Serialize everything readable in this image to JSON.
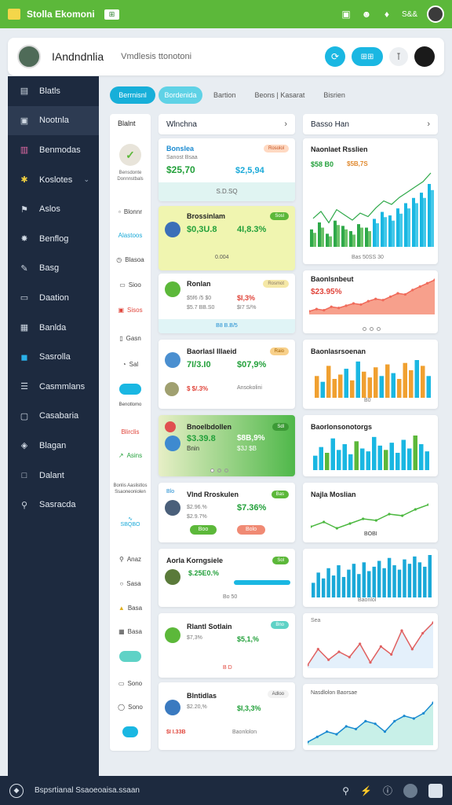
{
  "topbar": {
    "app_name": "Stolla Ekomoni",
    "badge": "⊞",
    "icons": [
      "screen-icon",
      "person-icon",
      "bell-icon"
    ],
    "status_text": "S&&"
  },
  "header": {
    "title": "IAndndnlia",
    "subtitle": "Vmdlesis ttonotoni",
    "pill_label": "⊞⊞",
    "gray_label": "⊺"
  },
  "sidebar": {
    "items": [
      {
        "label": "Blatls",
        "icon": "document-icon"
      },
      {
        "label": "Nootnla",
        "icon": "folder-icon"
      },
      {
        "label": "Benmodas",
        "icon": "chart-icon"
      },
      {
        "label": "Koslotes",
        "icon": "puzzle-icon"
      },
      {
        "label": "Aslos",
        "icon": "flag-icon"
      },
      {
        "label": "Benflog",
        "icon": "bug-icon"
      },
      {
        "label": "Basg",
        "icon": "pen-icon"
      },
      {
        "label": "Daation",
        "icon": "monitor-icon"
      },
      {
        "label": "Banlda",
        "icon": "calendar-icon"
      },
      {
        "label": "Sasrolla",
        "icon": "app-icon"
      },
      {
        "label": "Casmmlans",
        "icon": "list-icon"
      },
      {
        "label": "Casabaria",
        "icon": "box-icon"
      },
      {
        "label": "Blagan",
        "icon": "map-icon"
      },
      {
        "label": "Dalant",
        "icon": "square-icon"
      },
      {
        "label": "Sasracda",
        "icon": "search-icon"
      }
    ]
  },
  "tabs": [
    {
      "label": "Berrnisnl",
      "style": "primary"
    },
    {
      "label": "Bordenida",
      "style": "secondary"
    },
    {
      "label": "Bartion",
      "style": "plain"
    },
    {
      "label": "Beons | Kasarat",
      "style": "plain"
    },
    {
      "label": "Bisrien",
      "style": "plain"
    }
  ],
  "left_column": {
    "heading": "Blalnt",
    "items": [
      {
        "label": "Bensdonte Donnnstbals"
      },
      {
        "label": "Blonnr"
      },
      {
        "label": "Alastoos"
      },
      {
        "label": "Blasoa"
      },
      {
        "label": "Sioo"
      },
      {
        "label": "Sisos"
      },
      {
        "label": "Gasn"
      },
      {
        "label": "Sal"
      },
      {
        "label": "Benotlomo"
      },
      {
        "label": "Blirclis"
      },
      {
        "label": "Asins"
      },
      {
        "label": "Bonlis Aaslistlos Ssaoneoniolen"
      },
      {
        "label": "SBQBO"
      },
      {
        "label": "Anaz"
      },
      {
        "label": "Sasa"
      },
      {
        "label": "Basa"
      },
      {
        "label": "Basa"
      },
      {
        "label": "Sono"
      },
      {
        "label": "Sono"
      }
    ]
  },
  "mid_header": "Wlnchna",
  "right_header": "Basso Han",
  "mid_cards": [
    {
      "title": "Bonslea",
      "tag": "Rosolol",
      "sub": "Sanost Bsaa",
      "v1": "$25,70",
      "v2": "$2,5,94",
      "foot": "S.D.SQ"
    },
    {
      "title": "Brossinlam",
      "tag": "Sosl",
      "v1": "$0,3U.8",
      "v2": "4I,8.3%",
      "foot": "0.004"
    },
    {
      "title": "Ronlan",
      "tag": "Rosmot",
      "v1": "$I7 S/%",
      "v2": "$I,3%",
      "sub1": "$5f6 /5 $0",
      "sub2": "$5.7 BB.S0",
      "foot": "B8 B.B/5"
    },
    {
      "title": "Baorlasl Illaeid",
      "tag": "Raio",
      "v1": "7I/3.I0",
      "v2": "$07,9%",
      "sub": "$ $/.3%",
      "foot": "Ansokolini"
    },
    {
      "title": "Bnoelbdollen",
      "tag": "Sdl",
      "v1": "$3.39.8",
      "v2": "$8B,9%",
      "sub": "$3J $B",
      "foot": "Bnin"
    },
    {
      "title": "Vlnd Rroskulen",
      "tag": "Blo",
      "v1": "$2.96.%",
      "v2": "$7.36%",
      "sub": "$2.9.7%",
      "pill1": "Boo",
      "pill2": "Bolo"
    },
    {
      "title": "Aorla Korngsiele",
      "tag": "Sol",
      "v1": "$.25E0.%",
      "v2": "$80,9%",
      "foot": "Bo 50"
    },
    {
      "title": "Rlantl Sotlain",
      "tag": "Bno",
      "v1": "$7,3%",
      "v2": "$5,1,%",
      "foot": "B D"
    },
    {
      "title": "Blntidlas",
      "tag": "Adloo",
      "v1": "$2.20,%",
      "v2": "$I,3,3%",
      "sub": "$I I.33B",
      "foot": "Baonlolon"
    }
  ],
  "right_cards": [
    {
      "title": "Naonlaet Rsslien",
      "v1": "$58 B0",
      "v2": "$5B,7S",
      "foot": "Bas 50SS 30"
    },
    {
      "title": "Baonlsnbeut",
      "v1": "$23.95%"
    },
    {
      "title": "Baonlasrsoenan",
      "foot": "B0"
    },
    {
      "title": "Baorlonsonotorgs"
    },
    {
      "title": "Najla Moslian",
      "foot": "BOBI"
    },
    {
      "title": "Baonlol"
    },
    {
      "title": "Sea"
    },
    {
      "title": "Nasdlolon Baorsae"
    }
  ],
  "chart_data": [
    {
      "type": "bar",
      "title": "Naonlaet Rsslien",
      "series": [
        {
          "values": [
            20,
            28,
            15,
            30,
            24,
            18,
            26,
            22,
            32,
            40,
            36,
            44,
            50,
            56,
            62,
            72
          ]
        },
        {
          "values": [
            16,
            22,
            12,
            25,
            20,
            14,
            22,
            18,
            27,
            34,
            30,
            38,
            44,
            50,
            56,
            65
          ]
        }
      ]
    },
    {
      "type": "area",
      "title": "Baonlsnbeut",
      "values": [
        20,
        24,
        22,
        28,
        26,
        30,
        34,
        32,
        38,
        42,
        40,
        46,
        52,
        50,
        58,
        64,
        70,
        76
      ]
    },
    {
      "type": "bar",
      "title": "Baonlasrsoenan",
      "values": [
        30,
        22,
        44,
        26,
        32,
        40,
        24,
        50,
        36,
        28,
        42,
        30,
        46,
        34,
        26,
        48,
        38,
        52,
        44,
        30
      ]
    },
    {
      "type": "bar",
      "title": "Baorlonsonotorgs",
      "values": [
        20,
        32,
        24,
        44,
        28,
        36,
        22,
        40,
        30,
        26,
        46,
        34,
        28,
        38,
        24,
        42,
        30,
        48,
        36,
        26
      ]
    },
    {
      "type": "line",
      "title": "Najla Moslian",
      "values": [
        30,
        36,
        28,
        34,
        40,
        38,
        46,
        44,
        52,
        58
      ]
    },
    {
      "type": "bar",
      "title": "Baonlol",
      "values": [
        20,
        34,
        26,
        40,
        30,
        44,
        28,
        38,
        46,
        32,
        48,
        36,
        42,
        50,
        40,
        54,
        44,
        38,
        52,
        46,
        56,
        48,
        42,
        58
      ]
    },
    {
      "type": "line",
      "title": "Sea",
      "values": [
        26,
        38,
        30,
        36,
        32,
        42,
        28,
        40,
        34,
        52,
        38,
        50,
        58
      ]
    },
    {
      "type": "area",
      "title": "Nasdlolon Baorsae",
      "values": [
        18,
        22,
        26,
        24,
        30,
        28,
        34,
        32,
        26,
        34,
        38,
        36,
        40,
        48
      ]
    }
  ],
  "bottombar": {
    "text": "Bspsrtianal Ssaoeoaisa.ssaan"
  },
  "colors": {
    "green": "#5cb83a",
    "navy": "#1d2a3f",
    "teal": "#1ab7e2",
    "orange": "#f0a030",
    "salmon": "#f08a74"
  }
}
